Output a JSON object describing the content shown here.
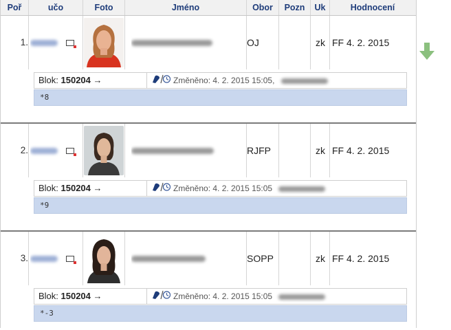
{
  "columns": {
    "por": "Poř",
    "uco": "učo",
    "foto": "Foto",
    "jmeno": "Jméno",
    "obor": "Obor",
    "pozn": "Pozn",
    "uk": "Uk",
    "hodnoceni": "Hodnocení"
  },
  "rows": [
    {
      "num": "1.",
      "obor": "OJ",
      "pozn": "",
      "uk": "zk",
      "hodnoceni": "FF 4. 2. 2015",
      "blok_label": "Blok: ",
      "blok_code": "150204",
      "blok_arrow": "→",
      "changed": "Změněno: 4. 2. 2015 15:05,",
      "note": "*8"
    },
    {
      "num": "2.",
      "obor": "RJFP",
      "pozn": "",
      "uk": "zk",
      "hodnoceni": "FF 4. 2. 2015",
      "blok_label": "Blok: ",
      "blok_code": "150204",
      "blok_arrow": "→",
      "changed": "Změněno: 4. 2. 2015 15:05",
      "note": "*9"
    },
    {
      "num": "3.",
      "obor": "SOPP",
      "pozn": "",
      "uk": "zk",
      "hodnoceni": "FF 4. 2. 2015",
      "blok_label": "Blok: ",
      "blok_code": "150204",
      "blok_arrow": "→",
      "changed": "Změněno: 4. 2. 2015 15:05",
      "note": "*-3"
    }
  ],
  "icons": {
    "row_page": "page-link-icon",
    "notes": "note-edit-icon",
    "history": "clock-history-icon",
    "scroll": "arrow-down-icon"
  },
  "colors": {
    "header_text": "#1e3c7a",
    "note_bg": "#c9d7ee",
    "arrow": "#8bc07e"
  }
}
